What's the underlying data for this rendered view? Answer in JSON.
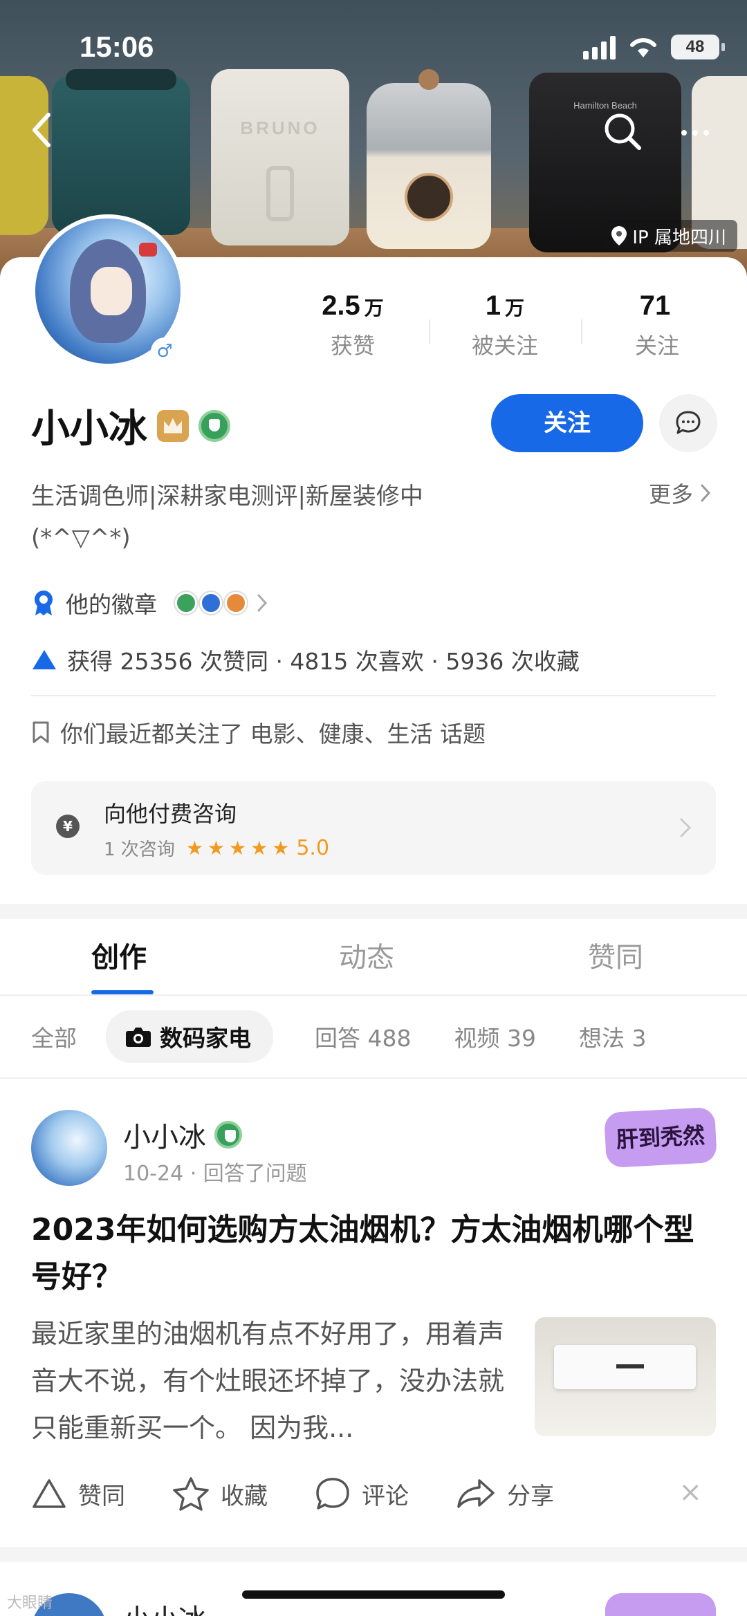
{
  "status": {
    "time": "15:06",
    "battery": "48"
  },
  "header": {
    "ip_label": "IP 属地四川",
    "banner_brand": "BRUNO",
    "banner_label": "Hamilton Beach"
  },
  "profile": {
    "name": "小小冰",
    "stats": [
      {
        "value": "2.5",
        "unit": "万",
        "label": "获赞"
      },
      {
        "value": "1",
        "unit": "万",
        "label": "被关注"
      },
      {
        "value": "71",
        "unit": "",
        "label": "关注"
      }
    ],
    "follow_label": "关注",
    "bio": "生活调色师|深耕家电测评|新屋装修中 (*^▽^*)",
    "more_label": "更多",
    "badges_label": "他的徽章",
    "votes_text": "获得 25356 次赞同 · 4815 次喜欢 · 5936 次收藏",
    "topics_text": "你们最近都关注了 电影、健康、生活 话题"
  },
  "consult": {
    "icon": "¥",
    "title": "向他付费咨询",
    "count": "1 次咨询",
    "stars": "★★★★★",
    "rating": "5.0"
  },
  "tabs": [
    {
      "label": "创作"
    },
    {
      "label": "动态"
    },
    {
      "label": "赞同"
    }
  ],
  "filters": [
    {
      "label": "全部"
    },
    {
      "label": "数码家电"
    },
    {
      "label": "回答 488"
    },
    {
      "label": "视频 39"
    },
    {
      "label": "想法 3"
    }
  ],
  "feed": {
    "item": {
      "author": "小小冰",
      "meta": "10-24 · 回答了问题",
      "sticker": "肝到秃然",
      "title": "2023年如何选购方太油烟机？方太油烟机哪个型号好？",
      "excerpt": "最近家里的油烟机有点不好用了，用着声音大不说，有个灶眼还坏掉了，没办法就只能重新买一个。 因为我...",
      "actions": {
        "upvote": "赞同",
        "favorite": "收藏",
        "comment": "评论",
        "share": "分享",
        "close": "×"
      }
    },
    "next_author": "小小冰"
  },
  "watermark": "大眼睛"
}
